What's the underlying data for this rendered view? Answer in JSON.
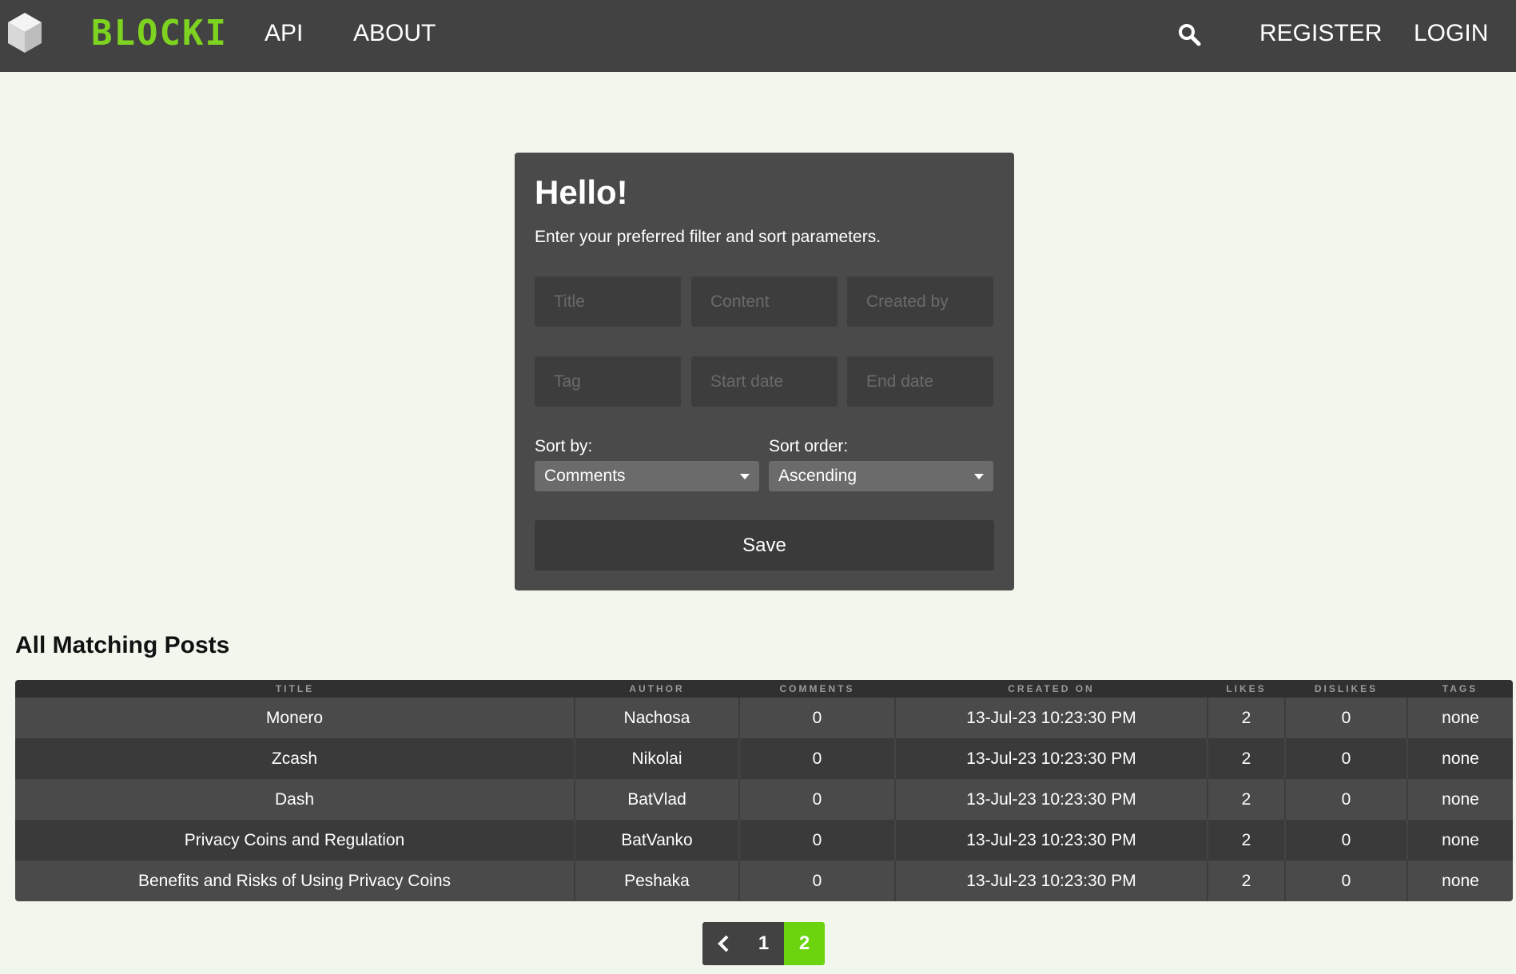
{
  "nav": {
    "brand": "BLOCKI",
    "links": [
      "API",
      "ABOUT"
    ],
    "register": "REGISTER",
    "login": "LOGIN"
  },
  "card": {
    "title": "Hello!",
    "subtitle": "Enter your preferred filter and sort parameters.",
    "placeholders": {
      "title": "Title",
      "content": "Content",
      "created_by": "Created by",
      "tag": "Tag",
      "start_date": "Start date",
      "end_date": "End date"
    },
    "sort_by_label": "Sort by:",
    "sort_by_value": "Comments",
    "sort_order_label": "Sort order:",
    "sort_order_value": "Ascending",
    "save_label": "Save"
  },
  "posts": {
    "heading": "All Matching Posts",
    "columns": [
      "TITLE",
      "AUTHOR",
      "COMMENTS",
      "CREATED ON",
      "LIKES",
      "DISLIKES",
      "TAGS"
    ],
    "rows": [
      [
        "Monero",
        "Nachosa",
        "0",
        "13-Jul-23 10:23:30 PM",
        "2",
        "0",
        "none"
      ],
      [
        "Zcash",
        "Nikolai",
        "0",
        "13-Jul-23 10:23:30 PM",
        "2",
        "0",
        "none"
      ],
      [
        "Dash",
        "BatVlad",
        "0",
        "13-Jul-23 10:23:30 PM",
        "2",
        "0",
        "none"
      ],
      [
        "Privacy Coins and Regulation",
        "BatVanko",
        "0",
        "13-Jul-23 10:23:30 PM",
        "2",
        "0",
        "none"
      ],
      [
        "Benefits and Risks of Using Privacy Coins",
        "Peshaka",
        "0",
        "13-Jul-23 10:23:30 PM",
        "2",
        "0",
        "none"
      ]
    ]
  },
  "pagination": {
    "pages": [
      "1",
      "2"
    ],
    "current": "2"
  },
  "colors": {
    "accent": "#7ed321",
    "navbar": "#424242",
    "background": "#f2f7ee",
    "card": "#4a4a4a"
  },
  "icons": {
    "logo": "cube-icon",
    "search": "search-icon",
    "prev": "chevron-left-icon",
    "caret": "caret-down-icon"
  }
}
